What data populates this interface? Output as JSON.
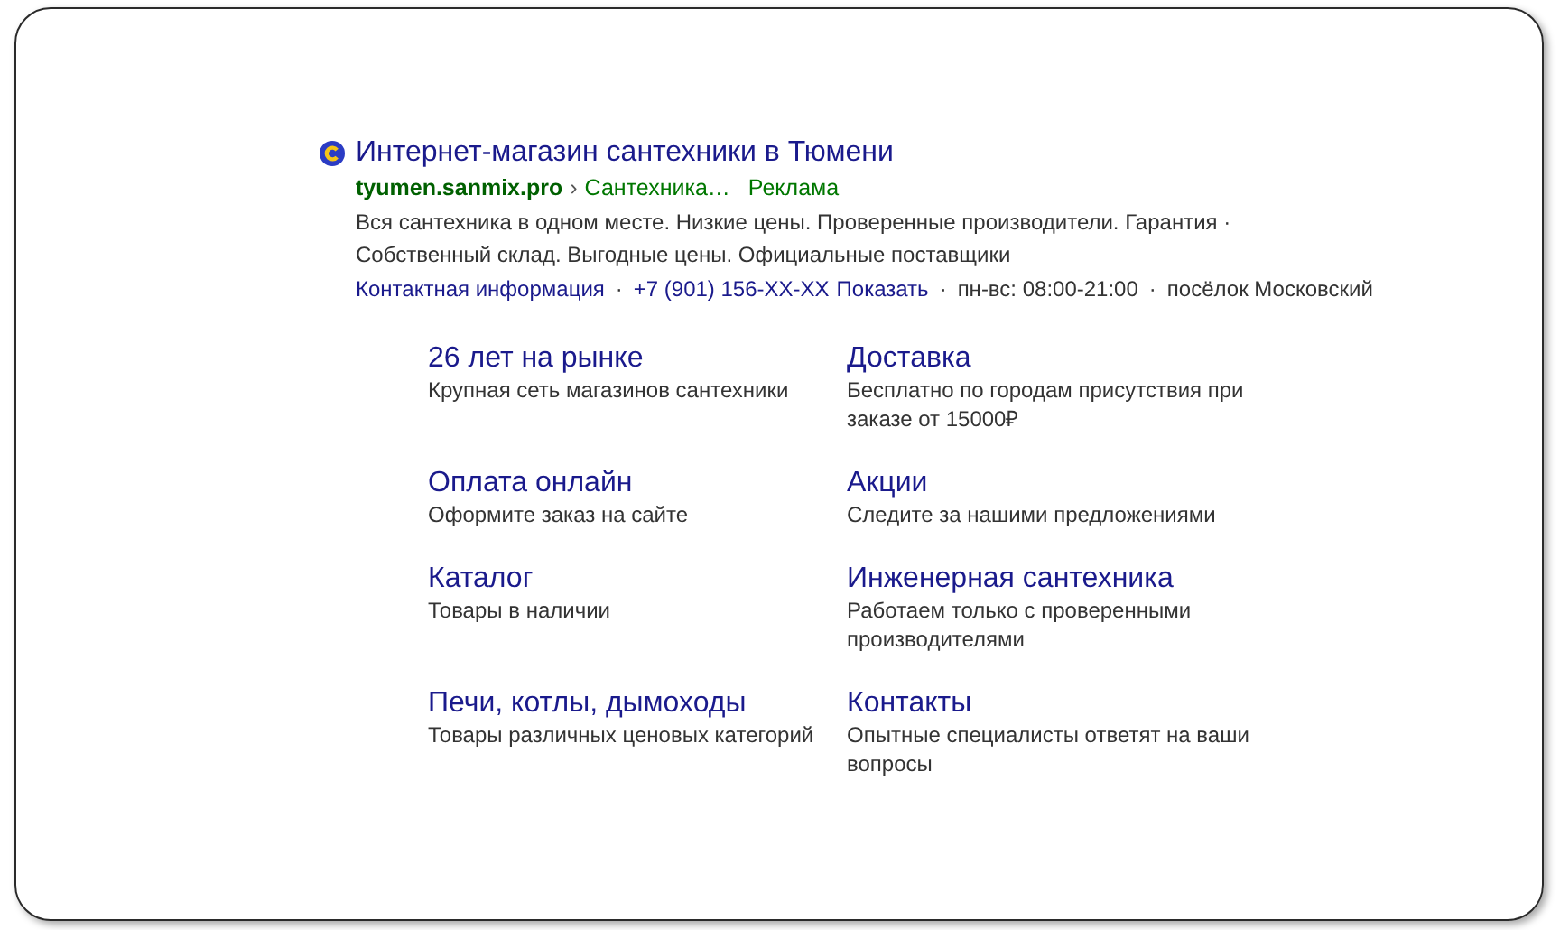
{
  "ad": {
    "title": "Интернет-магазин сантехники в Тюмени",
    "domain": "tyumen.sanmix.pro",
    "breadcrumb_separator": "›",
    "breadcrumb": "Сантехника…",
    "label": "Реклама",
    "description": "Вся сантехника в одном месте. Низкие цены. Проверенные производители. Гарантия · Собственный склад. Выгодные цены. Официальные поставщики",
    "contacts": [
      {
        "kind": "link",
        "text": "Контактная информация"
      },
      {
        "kind": "phone",
        "text": "+7 (901) 156-XX-XX",
        "action": "Показать"
      },
      {
        "kind": "plain",
        "text": "пн-вс: 08:00-21:00"
      },
      {
        "kind": "plain",
        "text": "посёлок Московский"
      }
    ],
    "contact_separator": "·",
    "sitelinks": [
      {
        "title": "26 лет на рынке",
        "description": "Крупная сеть магазинов сантехники"
      },
      {
        "title": "Доставка",
        "description": "Бесплатно по городам присутствия при заказе от 15000₽"
      },
      {
        "title": "Оплата онлайн",
        "description": "Оформите заказ на сайте"
      },
      {
        "title": "Акции",
        "description": "Следите за нашими предложениями"
      },
      {
        "title": "Каталог",
        "description": "Товары в наличии"
      },
      {
        "title": "Инженерная сантехника",
        "description": "Работаем только с проверенными производителями"
      },
      {
        "title": "Печи, котлы, дымоходы",
        "description": "Товары различных ценовых категорий"
      },
      {
        "title": "Контакты",
        "description": "Опытные специалисты ответят на ваши вопросы"
      }
    ]
  }
}
